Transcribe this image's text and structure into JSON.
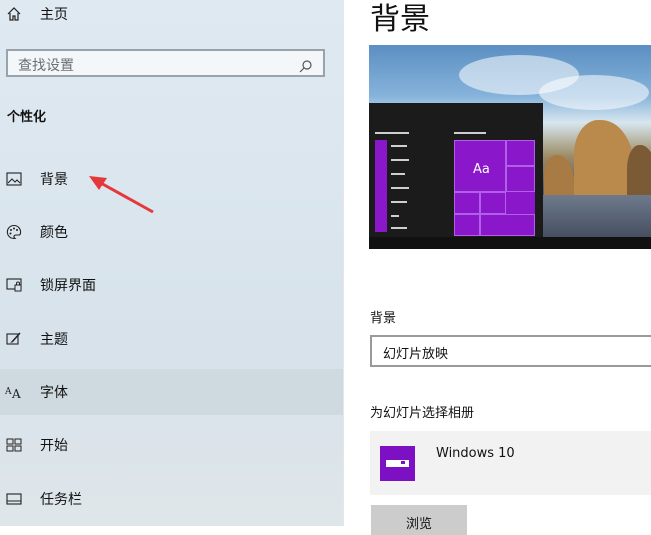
{
  "sidebar": {
    "home_label": "主页",
    "search_placeholder": "查找设置",
    "section_title": "个性化",
    "items": [
      {
        "label": "背景",
        "icon": "picture-icon"
      },
      {
        "label": "颜色",
        "icon": "palette-icon"
      },
      {
        "label": "锁屏界面",
        "icon": "lock-screen-icon"
      },
      {
        "label": "主题",
        "icon": "theme-brush-icon"
      },
      {
        "label": "字体",
        "icon": "font-icon"
      },
      {
        "label": "开始",
        "icon": "start-grid-icon"
      },
      {
        "label": "任务栏",
        "icon": "taskbar-icon"
      }
    ],
    "font_icon_text": "Aᴬ"
  },
  "main": {
    "title": "背景",
    "preview_tile_text": "Aa",
    "background_label": "背景",
    "background_value": "幻灯片放映",
    "album_label": "为幻灯片选择相册",
    "album_name": "Windows 10",
    "browse_label": "浏览"
  },
  "colors": {
    "accent": "#8a17c9",
    "annotation_arrow": "#e5383b"
  }
}
